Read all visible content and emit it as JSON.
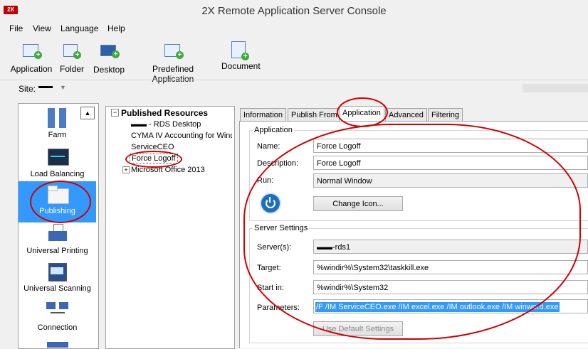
{
  "window": {
    "title": "2X Remote Application Server Console",
    "logo_text": "2X"
  },
  "menu": [
    "File",
    "View",
    "Language",
    "Help"
  ],
  "toolbar": {
    "application": "Application",
    "folder": "Folder",
    "desktop": "Desktop",
    "predefined": "Predefined Application",
    "document": "Document"
  },
  "site": {
    "label": "Site:",
    "value": "▬▬"
  },
  "nav": {
    "farm": "Farm",
    "load_balancing": "Load Balancing",
    "publishing": "Publishing",
    "universal_printing": "Universal Printing",
    "universal_scanning": "Universal Scanning",
    "connection": "Connection",
    "scroll_up_glyph": "▲"
  },
  "tree": {
    "root": "Published Resources",
    "items": [
      "▬▬ - RDS Desktop",
      "CYMA IV Accounting for Windows",
      "ServiceCEO",
      "Force Logoff",
      "Microsoft Office 2013"
    ],
    "collapse_glyph": "−",
    "expand_glyph": "+"
  },
  "tabs": [
    "Information",
    "Publish From",
    "Application",
    "Advanced",
    "Filtering"
  ],
  "application": {
    "group_title": "Application",
    "name_label": "Name:",
    "name_value": "Force Logoff",
    "description_label": "Description:",
    "description_value": "Force Logoff",
    "run_label": "Run:",
    "run_value": "Normal Window",
    "change_icon": "Change Icon..."
  },
  "server": {
    "group_title": "Server Settings",
    "servers_label": "Server(s):",
    "servers_value": "▬▬-rds1",
    "target_label": "Target:",
    "target_value": "%windir%\\System32\\taskkill.exe",
    "startin_label": "Start in:",
    "startin_value": "%windir%\\System32",
    "params_label": "Parameters:",
    "params_value": "/F /IM ServiceCEO.exe /IM excel.exe /IM outlook.exe /IM winword.exe",
    "default_btn": "Use Default Settings"
  },
  "colors": {
    "accent": "#3399ff",
    "annotation": "#d00000",
    "selected_nav": "#3399ff"
  }
}
